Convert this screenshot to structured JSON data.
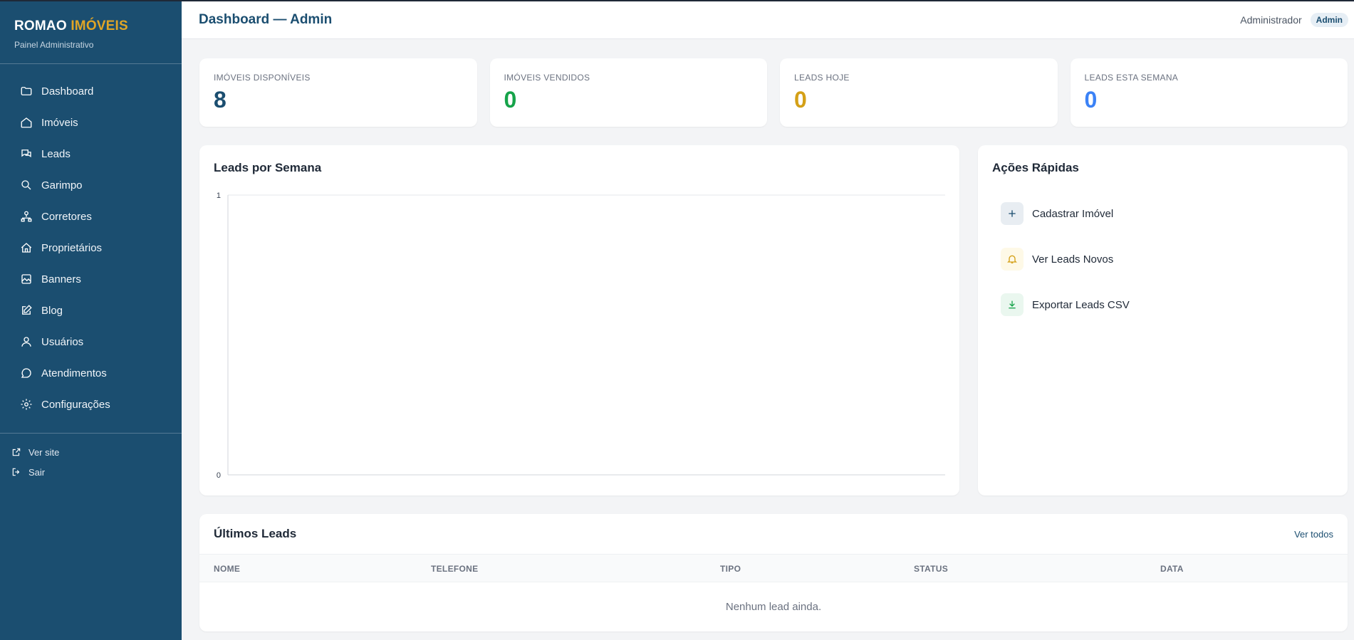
{
  "brand": {
    "name_main": "ROMAO",
    "name_accent": "IMÓVEIS",
    "subtitle": "Painel Administrativo"
  },
  "sidebar": {
    "items": [
      {
        "label": "Dashboard",
        "icon": "folder-icon"
      },
      {
        "label": "Imóveis",
        "icon": "home-icon"
      },
      {
        "label": "Leads",
        "icon": "chat-icon"
      },
      {
        "label": "Garimpo",
        "icon": "search-icon"
      },
      {
        "label": "Corretores",
        "icon": "network-icon"
      },
      {
        "label": "Proprietários",
        "icon": "house-icon"
      },
      {
        "label": "Banners",
        "icon": "image-icon"
      },
      {
        "label": "Blog",
        "icon": "edit-icon"
      },
      {
        "label": "Usuários",
        "icon": "user-icon"
      },
      {
        "label": "Atendimentos",
        "icon": "message-icon"
      },
      {
        "label": "Configurações",
        "icon": "gear-icon"
      }
    ],
    "footer": [
      {
        "label": "Ver site",
        "icon": "external-link-icon"
      },
      {
        "label": "Sair",
        "icon": "logout-icon"
      }
    ]
  },
  "header": {
    "title": "Dashboard — Admin",
    "user": "Administrador",
    "role": "Admin"
  },
  "stats": [
    {
      "label": "IMÓVEIS DISPONÍVEIS",
      "value": "8",
      "color": "#1b4e70"
    },
    {
      "label": "IMÓVEIS VENDIDOS",
      "value": "0",
      "color": "#16a34a"
    },
    {
      "label": "LEADS HOJE",
      "value": "0",
      "color": "#d4a017"
    },
    {
      "label": "LEADS ESTA SEMANA",
      "value": "0",
      "color": "#3b82f6"
    }
  ],
  "chart": {
    "title": "Leads por Semana"
  },
  "chart_data": {
    "type": "line",
    "title": "Leads por Semana",
    "xlabel": "",
    "ylabel": "",
    "y_ticks": [
      "0",
      "1"
    ],
    "ylim": [
      0,
      1
    ],
    "series": []
  },
  "quick_actions": {
    "title": "Ações Rápidas",
    "items": [
      {
        "label": "Cadastrar Imóvel",
        "icon": "plus-icon"
      },
      {
        "label": "Ver Leads Novos",
        "icon": "bell-icon"
      },
      {
        "label": "Exportar Leads CSV",
        "icon": "download-icon"
      }
    ]
  },
  "leads_table": {
    "title": "Últimos Leads",
    "view_all": "Ver todos",
    "columns": [
      "NOME",
      "TELEFONE",
      "TIPO",
      "STATUS",
      "DATA"
    ],
    "empty_text": "Nenhum lead ainda."
  }
}
